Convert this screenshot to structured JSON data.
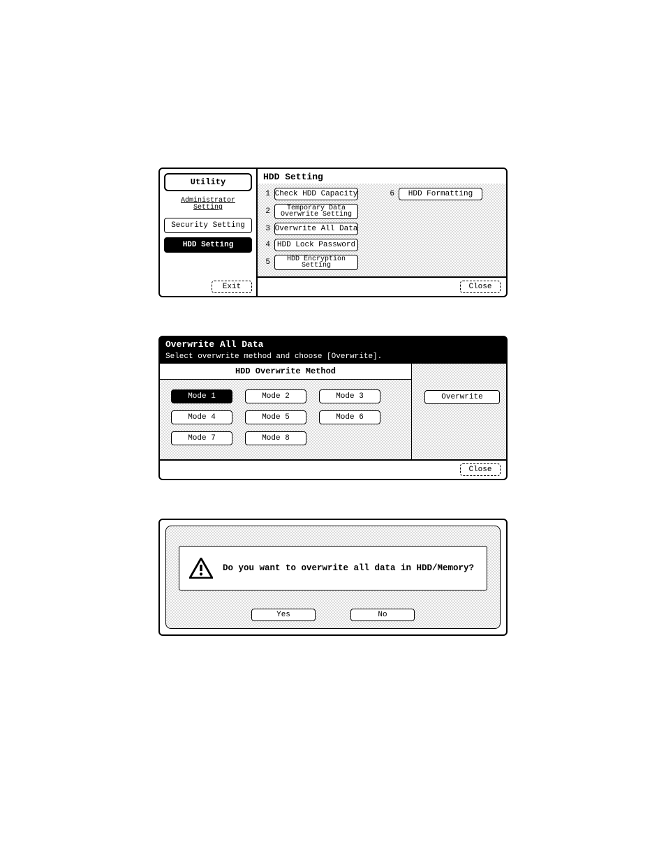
{
  "screen1": {
    "sidebar": {
      "pill": "Utility",
      "crumbs": [
        {
          "label": "Administrator\nSetting",
          "underline": true
        },
        {
          "label": "Security Setting",
          "boxed": true
        },
        {
          "label": "HDD Setting",
          "selected": true
        }
      ],
      "exit": "Exit"
    },
    "main": {
      "title": "HDD Setting",
      "items_left": [
        {
          "n": "1",
          "label": "Check HDD Capacity"
        },
        {
          "n": "2",
          "label": "Temporary Data\nOverwrite Setting",
          "small": true
        },
        {
          "n": "3",
          "label": "Overwrite All Data"
        },
        {
          "n": "4",
          "label": "HDD Lock Password"
        },
        {
          "n": "5",
          "label": "HDD Encryption\nSetting",
          "small": true
        }
      ],
      "items_right": [
        {
          "n": "6",
          "label": "HDD Formatting"
        }
      ],
      "close": "Close"
    }
  },
  "screen2": {
    "title": "Overwrite All Data",
    "subtitle": "Select overwrite method and choose [Overwrite].",
    "method_header": "HDD Overwrite Method",
    "modes": [
      [
        "Mode 1",
        "Mode 2",
        "Mode 3"
      ],
      [
        "Mode 4",
        "Mode 5",
        "Mode 6"
      ],
      [
        "Mode 7",
        "Mode 8"
      ]
    ],
    "selected_mode": "Mode 1",
    "overwrite": "Overwrite",
    "close": "Close"
  },
  "screen3": {
    "message": "Do you want to overwrite all data in HDD/Memory?",
    "yes": "Yes",
    "no": "No"
  }
}
